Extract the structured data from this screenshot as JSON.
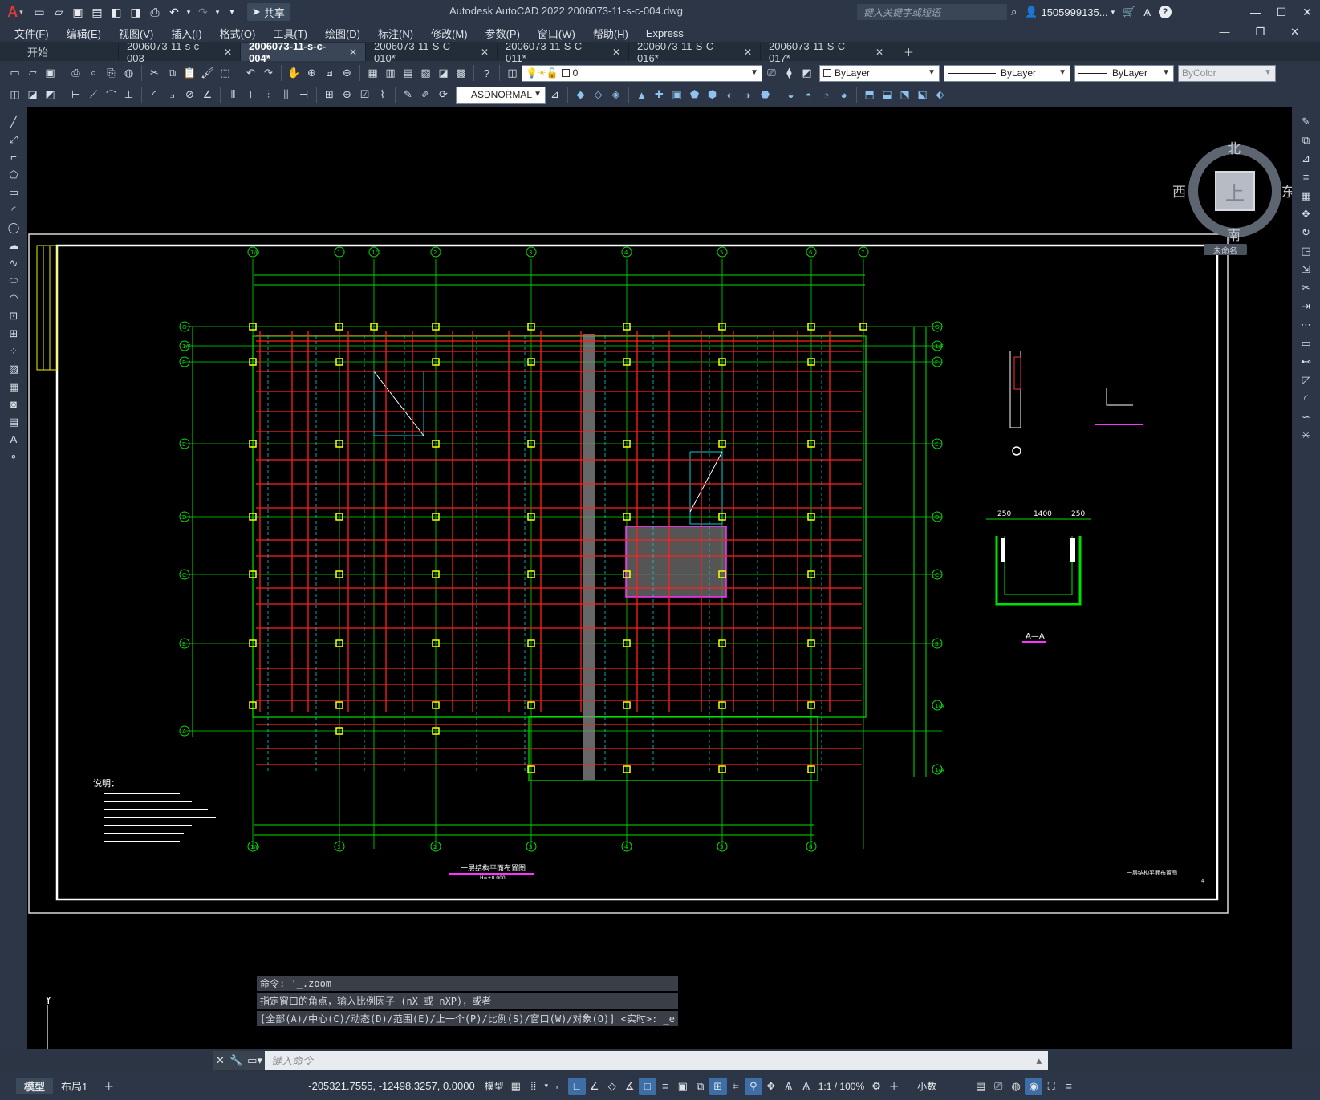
{
  "app": {
    "logo": "A",
    "title": "Autodesk AutoCAD 2022    2006073-11-s-c-004.dwg",
    "search_placeholder": "键入关键字或短语",
    "user": "1505999135...",
    "share_label": "共享"
  },
  "menu": [
    "文件(F)",
    "编辑(E)",
    "视图(V)",
    "插入(I)",
    "格式(O)",
    "工具(T)",
    "绘图(D)",
    "标注(N)",
    "修改(M)",
    "参数(P)",
    "窗口(W)",
    "帮助(H)",
    "Express"
  ],
  "tabs": [
    {
      "label": "开始",
      "closable": false,
      "active": false
    },
    {
      "label": "2006073-11-s-c-003",
      "closable": true,
      "active": false
    },
    {
      "label": "2006073-11-s-c-004*",
      "closable": true,
      "active": true
    },
    {
      "label": "2006073-11-S-C-010*",
      "closable": true,
      "active": false
    },
    {
      "label": "2006073-11-S-C-011*",
      "closable": true,
      "active": false
    },
    {
      "label": "2006073-11-S-C-016*",
      "closable": true,
      "active": false
    },
    {
      "label": "2006073-11-S-C-017*",
      "closable": true,
      "active": false
    }
  ],
  "properties": {
    "layer": "0",
    "color": "ByLayer",
    "linetype": "ByLayer",
    "lineweight": "ByLayer",
    "plotstyle": "ByColor",
    "dimstyle": "ASDNORMAL"
  },
  "viewcube": {
    "north": "北",
    "south": "南",
    "east": "东",
    "west": "西",
    "top": "上",
    "ucs_menu": "未命名"
  },
  "ucs_icon": {
    "x": "X",
    "y": "Y"
  },
  "drawing": {
    "title": "一层结构平面布置图",
    "elevation": "H=±0.000",
    "notes_title": "说明：",
    "section_title": "A—A",
    "sheet_title": "一层结构平面布置图",
    "sheet_number": "4",
    "column_axes_top": [
      "1/0",
      "1",
      "1/1",
      "2",
      "3",
      "4",
      "5",
      "6",
      "7"
    ],
    "column_axes_bottom": [
      "1/0",
      "1",
      "2",
      "3",
      "4",
      "5",
      "6"
    ],
    "row_axes_left": [
      "G",
      "1/F",
      "F",
      "E",
      "D",
      "C",
      "B",
      "A"
    ],
    "row_axes_right": [
      "G",
      "1/F",
      "F",
      "E",
      "D",
      "C",
      "B",
      "1/A",
      "1/A"
    ],
    "section_dims": [
      "250",
      "1400",
      "250"
    ]
  },
  "command": {
    "history": [
      "命令: '_.zoom",
      "指定窗口的角点，输入比例因子 (nX 或 nXP)，或者",
      "[全部(A)/中心(C)/动态(D)/范围(E)/上一个(P)/比例(S)/窗口(W)/对象(O)] <实时>: _e"
    ],
    "placeholder": "键入命令"
  },
  "status": {
    "layout_tabs": [
      "模型",
      "布局1"
    ],
    "coordinates": "-205321.7555, -12498.3257, 0.0000",
    "space": "模型",
    "scale": "1:1 / 100%",
    "units": "小数"
  }
}
